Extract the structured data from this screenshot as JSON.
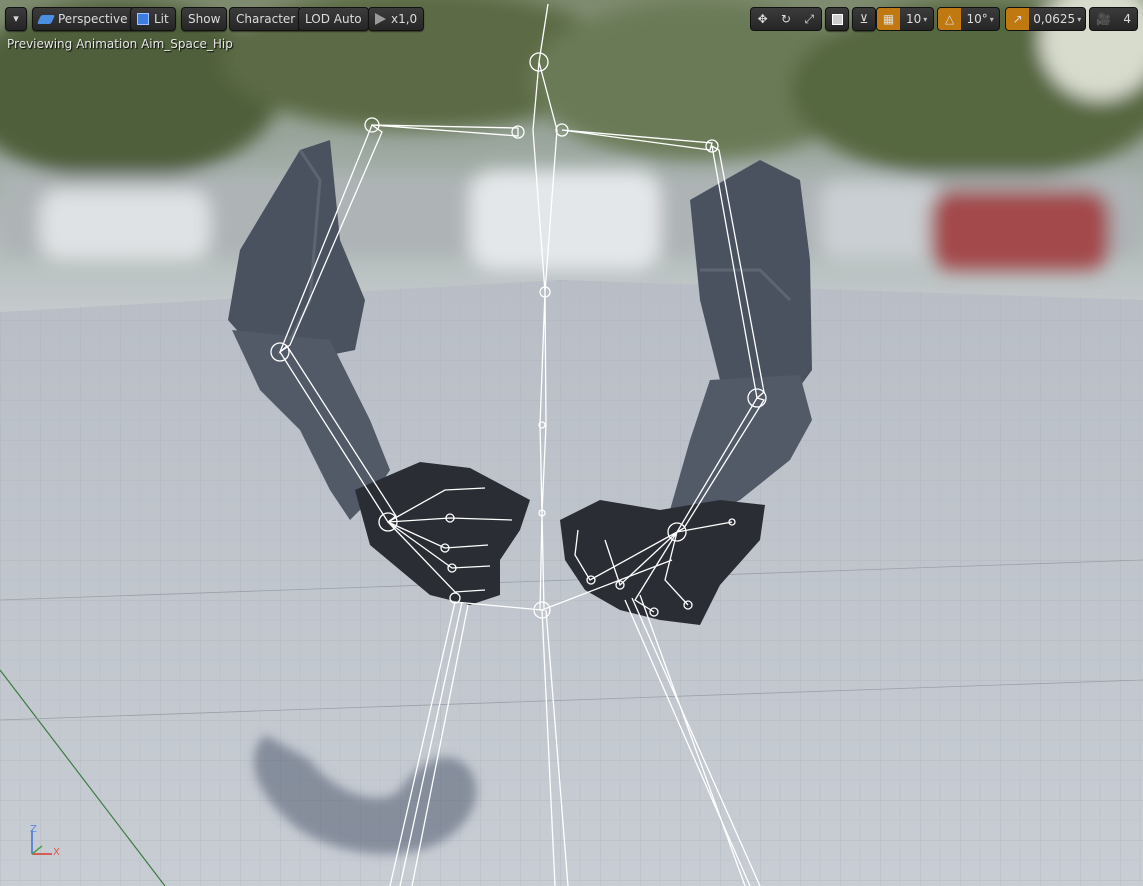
{
  "toolbar": {
    "menu_caret": "▾",
    "perspective_label": "Perspective",
    "lit_label": "Lit",
    "show_label": "Show",
    "character_label": "Character",
    "lod_label": "LOD Auto",
    "playback_speed_label": "x1,0",
    "grid_snap_value": "10",
    "rotation_snap_value": "10°",
    "scale_snap_value": "0,0625",
    "camera_speed_value": "4"
  },
  "viewport": {
    "preview_text": "Previewing Animation Aim_Space_Hip"
  },
  "axis_widget": {
    "z_label": "Z",
    "x_label": "X"
  },
  "colors": {
    "toolbar_bg": "#2b2b2b",
    "accent_orange": "#d98a18",
    "bone_color": "#ffffff",
    "grid_floor": "#c3c8d0",
    "sky_blur": "#8f9a86"
  },
  "icons": {
    "perspective": "perspective-icon",
    "lit": "lit-cube-icon",
    "speed": "play-triangle-icon",
    "translate": "translate-arrows-icon",
    "rotate": "rotate-icon",
    "scale": "scale-icon",
    "world_local": "cube-icon",
    "surface_snap": "surface-snap-icon",
    "grid_snap": "grid-icon",
    "rotation_snap": "angle-icon",
    "scale_snap": "scale-arrow-icon",
    "camera_speed": "camera-icon"
  }
}
